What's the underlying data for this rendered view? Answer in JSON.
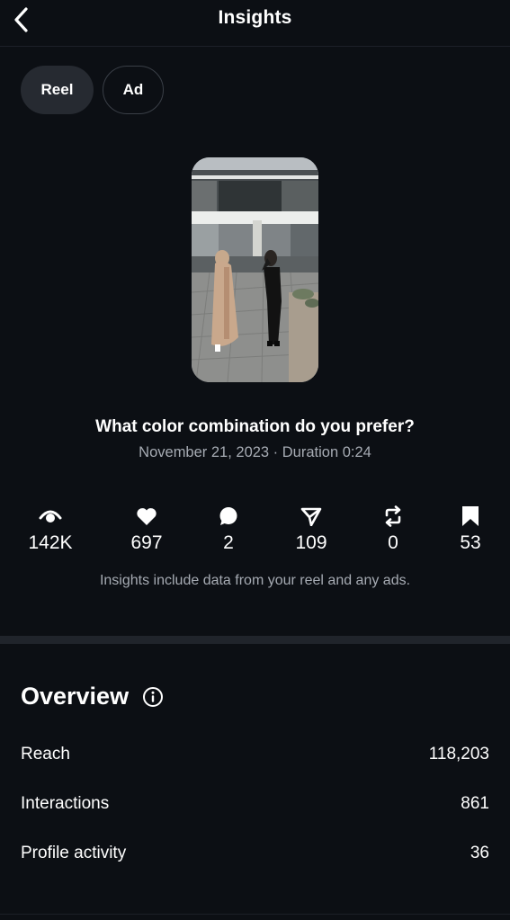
{
  "header": {
    "title": "Insights",
    "back_icon": "chevron-left-icon"
  },
  "tabs": [
    {
      "label": "Reel",
      "selected": true
    },
    {
      "label": "Ad",
      "selected": false
    }
  ],
  "reel": {
    "title": "What color combination do you prefer?",
    "meta": "November 21, 2023 · Duration 0:24"
  },
  "stats": [
    {
      "icon": "eye-icon",
      "value": "142K"
    },
    {
      "icon": "heart-icon",
      "value": "697"
    },
    {
      "icon": "comment-icon",
      "value": "2"
    },
    {
      "icon": "send-icon",
      "value": "109"
    },
    {
      "icon": "repost-icon",
      "value": "0"
    },
    {
      "icon": "bookmark-icon",
      "value": "53"
    }
  ],
  "disclaimer": "Insights include data from your reel and any ads.",
  "overview": {
    "title": "Overview",
    "info_icon": "info-icon",
    "rows": [
      {
        "label": "Reach",
        "value": "118,203"
      },
      {
        "label": "Interactions",
        "value": "861"
      },
      {
        "label": "Profile activity",
        "value": "36"
      }
    ]
  },
  "colors": {
    "background": "#0c0f14",
    "selected_tab": "#262a31",
    "muted_text": "#a6abb3"
  }
}
